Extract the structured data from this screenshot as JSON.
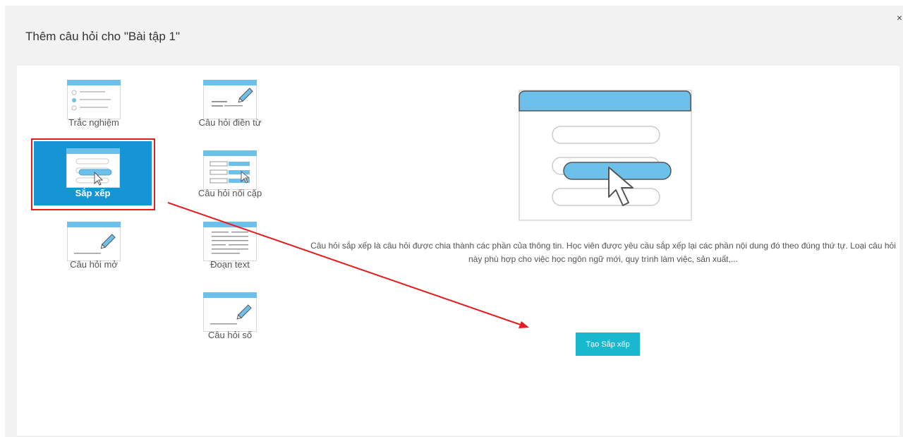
{
  "modal": {
    "title": "Thêm câu hỏi cho \"Bài tập 1\"",
    "close_symbol": "×"
  },
  "question_types": [
    {
      "label": "Trắc nghiệm",
      "icon": "multiple-choice-icon",
      "selected": false
    },
    {
      "label": "Câu hỏi điền từ",
      "icon": "fill-word-icon",
      "selected": false
    },
    {
      "label": "Sắp xếp",
      "icon": "sort-icon",
      "selected": true
    },
    {
      "label": "Câu hỏi nối cặp",
      "icon": "match-pairs-icon",
      "selected": false
    },
    {
      "label": "Câu hỏi mở",
      "icon": "open-question-icon",
      "selected": false
    },
    {
      "label": "Đoạn text",
      "icon": "text-paragraph-icon",
      "selected": false
    },
    {
      "label": "Câu hỏi số",
      "icon": "number-question-icon",
      "selected": false
    }
  ],
  "preview": {
    "description": "Câu hỏi sắp xếp là câu hỏi được chia thành các phần của thông tin. Học viên được yêu cầu sắp xếp lại các phần nội dung đó theo đúng thứ tự. Loại câu hỏi này phù hợp cho việc học ngôn ngữ mới, quy trình làm việc, sản xuất,...",
    "create_button_label": "Tạo Sắp xếp"
  },
  "colors": {
    "selected_tile": "#1595d3",
    "icon_blue": "#6cc0ea",
    "button": "#19b8cf",
    "annotation_red": "#e51c1c"
  }
}
